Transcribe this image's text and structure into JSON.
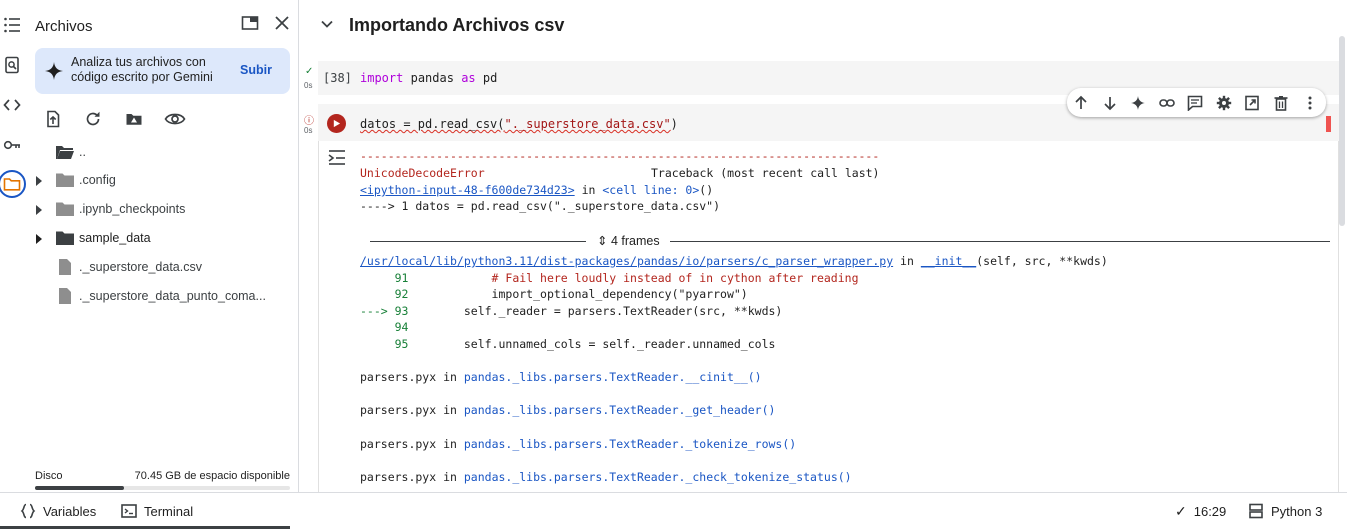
{
  "panel": {
    "title": "Archivos",
    "gemini_text": "Analiza tus archivos con código escrito por Gemini",
    "gemini_action": "Subir",
    "tree": [
      {
        "label": "..",
        "type": "folder-open"
      },
      {
        "label": ".config",
        "type": "folder-muted"
      },
      {
        "label": ".ipynb_checkpoints",
        "type": "folder-muted"
      },
      {
        "label": "sample_data",
        "type": "folder"
      },
      {
        "label": "._superstore_data.csv",
        "type": "file"
      },
      {
        "label": "._superstore_data_punto_coma...",
        "type": "file"
      }
    ],
    "disk_label": "Disco",
    "disk_free": "70.45 GB de espacio disponible",
    "disk_used_fraction": 0.35
  },
  "section": {
    "title": "Importando Archivos csv"
  },
  "cell1": {
    "count": "[38]",
    "kw_import": "import",
    "module": "pandas",
    "kw_as": "as",
    "alias": "pd",
    "exec_time": "0s"
  },
  "cell2": {
    "code_prefix": "datos = pd.read_csv(",
    "code_arg": "\"._superstore_data.csv\"",
    "code_suffix": ")",
    "exec_time": "0s"
  },
  "traceback": {
    "dashes": "---------------------------------------------------------------------------",
    "error_name": "UnicodeDecodeError",
    "header_right": "Traceback (most recent call last)",
    "input_ref": "<ipython-input-48-f600de734d23>",
    "in_word": " in ",
    "cell_ref": "<cell line: 0>",
    "cell_ref_tail": "()",
    "arrow_line": "----> 1 datos = pd.read_csv(\"._superstore_data.csv\")",
    "frames": "4 frames",
    "file_path": "/usr/local/lib/python3.11/dist-packages/pandas/io/parsers/c_parser_wrapper.py",
    "file_func": "__init__",
    "file_func_args": "(self, src, **kwds)",
    "src_lines": [
      {
        "prefix": "     91",
        "code": "            # Fail here loudly instead of in cython after reading"
      },
      {
        "prefix": "     92",
        "code": "            import_optional_dependency(\"pyarrow\")"
      },
      {
        "prefix": "---> 93",
        "code": "        self._reader = parsers.TextReader(src, **kwds)"
      },
      {
        "prefix": "     94",
        "code": ""
      },
      {
        "prefix": "     95",
        "code": "        self.unnamed_cols = self._reader.unnamed_cols"
      }
    ],
    "frames_list": [
      {
        "file": "parsers.pyx",
        "func": "pandas._libs.parsers.TextReader.__cinit__()"
      },
      {
        "file": "parsers.pyx",
        "func": "pandas._libs.parsers.TextReader._get_header()"
      },
      {
        "file": "parsers.pyx",
        "func": "pandas._libs.parsers.TextReader._tokenize_rows()"
      },
      {
        "file": "parsers.pyx",
        "func": "pandas._libs.parsers.TextReader._check_tokenize_status()"
      }
    ]
  },
  "status": {
    "variables": "Variables",
    "terminal": "Terminal",
    "time": "16:29",
    "runtime": "Python 3"
  },
  "colors": {
    "accent": "#1a56c4",
    "error": "#b3261e",
    "ok": "#188038"
  }
}
